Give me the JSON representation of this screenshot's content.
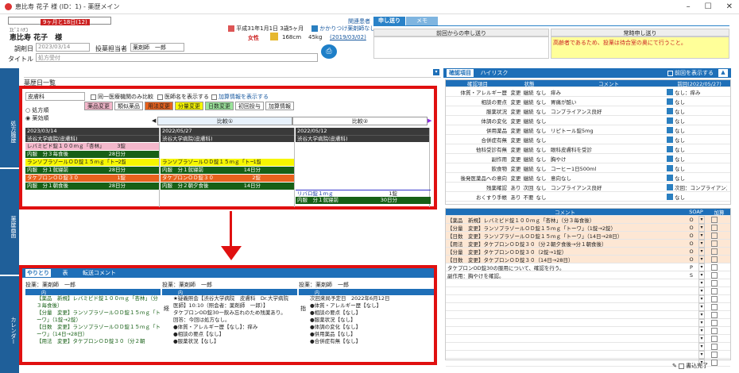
{
  "window": {
    "title": "恵比寿 花子 様 (ID：1) - 薬歴メイン"
  },
  "patient": {
    "age": "9ヶ月と18日(12)",
    "kana": "ｴﾋﾞｽ ﾊﾅｺ",
    "name": "恵比寿 花子　様",
    "birth": "平成31年1月1日 3歳5ヶ月",
    "sex": "女性",
    "height": "168cm",
    "weight": "45kg",
    "kakaritsuke": "かかりつけ薬剤師なし",
    "date_link": "(2019/03/02)",
    "related": "関連患者"
  },
  "form": {
    "date_label": "調剤日",
    "date_value": "2023/03/14",
    "pharmacist_label": "投薬担当者",
    "pharmacist_value": "薬剤師　一郎",
    "title_label": "タイトル",
    "title_value": "処方受付"
  },
  "notes": {
    "tab1": "申し送り",
    "tab2": "メモ",
    "prev_label": "前回からの申し送り",
    "always_label": "常時申し送り",
    "always_text": "高齢者であるため、投薬は待合室の奥にて行うこと。"
  },
  "history": {
    "title": "薬歴日一覧",
    "select": "皮膚科",
    "opt1": "同一医療機関のみ比較",
    "opt2": "医師名を表示する",
    "opt3": "加算情報を表示する",
    "radio1": "処方順",
    "radio2": "薬効順",
    "tags": [
      "薬品変更",
      "類似薬品",
      "用法変更",
      "分量変更",
      "日数変更",
      "初回投与",
      "加算情報"
    ],
    "compare1": "比較①",
    "compare2": "比較②",
    "columns": [
      {
        "date": "2023/03/14",
        "hosp": "渋谷大学病院(皮膚科)",
        "rows": [
          {
            "t": "レバミピド錠１００ｍｇ「杏林」",
            "n": "3錠",
            "c": "pink"
          },
          {
            "t": "内服　分３毎食後",
            "n": "28日分",
            "c": "grn"
          },
          {
            "t": "ランソプラゾールＯＤ錠１５ｍｇ「トーワ」",
            "n": "2錠",
            "c": "yel"
          },
          {
            "t": "内服　分１就寝前",
            "n": "28日分",
            "c": "grn"
          },
          {
            "t": "タケプロンＯＤ錠３０",
            "n": "1錠",
            "c": "org"
          },
          {
            "t": "内服　分１朝食後",
            "n": "28日分",
            "c": "grn"
          }
        ]
      },
      {
        "date": "2022/05/27",
        "hosp": "渋谷大学病院(皮膚科)",
        "rows": [
          {
            "t": "",
            "n": "",
            "c": ""
          },
          {
            "t": "",
            "n": "",
            "c": ""
          },
          {
            "t": "ランソプラゾールＯＤ錠１５ｍｇ「トーワ」",
            "n": "1錠",
            "c": "yel"
          },
          {
            "t": "内服　分１就寝前",
            "n": "14日分",
            "c": "grn"
          },
          {
            "t": "タケプロンＯＤ錠３０",
            "n": "2錠",
            "c": "org"
          },
          {
            "t": "内服　分２朝夕食後",
            "n": "14日分",
            "c": "grn"
          }
        ]
      },
      {
        "date": "2022/05/12",
        "hosp": "渋谷大学病院(皮膚科)",
        "rows": []
      }
    ],
    "extra": {
      "t1": "リバロ錠１ｍｇ",
      "n1": "1錠",
      "t2": "内服　分１就寝前",
      "n2": "30日分"
    }
  },
  "confirm": {
    "tab1": "確認項目",
    "tab2": "ハイリスク",
    "show_prev": "前回を表示する",
    "col_item": "確認項目",
    "col_state": "状態",
    "col_comment": "コメント",
    "col_prev": "前回(2022/05/27)",
    "rows": [
      {
        "item": "体質・アレルギー歴",
        "s1": "変更",
        "s2": "継続",
        "s3": "なし",
        "comment": "痒み",
        "prev": "なし：痒み"
      },
      {
        "item": "相談の要点",
        "s1": "変更",
        "s2": "継続",
        "s3": "なし",
        "comment": "胃痛が酷い",
        "prev": "なし"
      },
      {
        "item": "服薬状況",
        "s1": "変更",
        "s2": "継続",
        "s3": "なし",
        "comment": "コンプライアンス良好",
        "prev": "なし"
      },
      {
        "item": "体調の変化",
        "s1": "変更",
        "s2": "継続",
        "s3": "なし",
        "comment": "",
        "prev": "なし"
      },
      {
        "item": "併用薬品",
        "s1": "変更",
        "s2": "継続",
        "s3": "なし",
        "comment": "リピトール錠5mg",
        "prev": "なし"
      },
      {
        "item": "合併症有無",
        "s1": "変更",
        "s2": "継続",
        "s3": "なし",
        "comment": "",
        "prev": "なし"
      },
      {
        "item": "他科受診有無",
        "s1": "変更",
        "s2": "継続",
        "s3": "なし",
        "comment": "眼科皮膚科を受診",
        "prev": "なし"
      },
      {
        "item": "副作用",
        "s1": "変更",
        "s2": "継続",
        "s3": "なし",
        "comment": "胸やけ",
        "prev": "なし"
      },
      {
        "item": "飲食物",
        "s1": "変更",
        "s2": "継続",
        "s3": "なし",
        "comment": "コーヒー1日500ml",
        "prev": "なし"
      },
      {
        "item": "後発医薬品への意向",
        "s1": "変更",
        "s2": "継続",
        "s3": "なし",
        "comment": "意向なし",
        "prev": "なし"
      },
      {
        "item": "残薬確認",
        "s1": "あり",
        "s2": "次回",
        "s3": "なし",
        "comment": "コンプライアンス良好",
        "prev": "次回：コンプライアンス良好"
      },
      {
        "item": "おくすり手帳",
        "s1": "あり",
        "s2": "不要",
        "s3": "なし",
        "comment": "",
        "prev": "なし"
      }
    ]
  },
  "soap": {
    "col_comment": "コメント",
    "col_soap": "SOAP",
    "col_add": "加算",
    "rows": [
      {
        "t": "【薬品　新規】レバミピド錠１００ｍｇ「杏林」（分３毎食後）",
        "s": "O",
        "hl": true
      },
      {
        "t": "【分量　変更】ランソプラゾールＯＤ錠１５ｍｇ「トーワ」（1錠→2錠）",
        "s": "O",
        "hl": true
      },
      {
        "t": "【日数　変更】ランソプラゾールＯＤ錠１５ｍｇ「トーワ」（14日→28日）",
        "s": "O",
        "hl": true
      },
      {
        "t": "【用法　変更】タケプロンＯＤ錠３０（分２朝夕食後→分１朝食後）",
        "s": "O",
        "hl": true
      },
      {
        "t": "【分量　変更】タケプロンＯＤ錠３０（2錠→1錠）",
        "s": "O",
        "hl": true
      },
      {
        "t": "【日数　変更】タケプロンＯＤ錠３０（14日→28日）",
        "s": "O",
        "hl": true
      },
      {
        "t": "タケプロンOD錠30の服用について、確認を行う。",
        "s": "P",
        "hl": false
      },
      {
        "t": "副作用：胸やけを確認。",
        "s": "S",
        "hl": false
      }
    ],
    "done": "書込完了"
  },
  "bottom": {
    "tab1": "やりとり",
    "tab2": "表",
    "tab3": "転送コメント",
    "col1_title": "投薬：薬剤師　一郎",
    "col2_title": "投薬：薬剤師　一郎",
    "col3_title": "投薬：薬剤師　一郎",
    "col_head": "内",
    "col1": [
      "【薬品　新規】レバミピド錠１００ｍｇ「杏林」（分３毎食後）",
      "【分量　変更】ランソプラゾールＯＤ錠１５ｍｇ「トーワ」（1錠→2錠）",
      "【日数　変更】ランソプラゾールＯＤ錠１５ｍｇ「トーワ」（14日→28日）",
      "【用法　変更】タケプロンＯＤ錠３０（分２朝"
    ],
    "col2_mark": "経",
    "col2": [
      "★疑義照会【渋谷大学病院　皮膚科　Dr.大学病院　医師】10:10（照会者：薬剤師　一郎）】",
      "タケプロンOD錠30一飲み忘れのため残薬あり。",
      "回答：今回は処方なし。",
      "●体質・アレルギー歴【なし】：痒み",
      "●相談の要点【なし】",
      "●服薬状況【なし】"
    ],
    "col3_mark": "指",
    "col3": [
      "次回来局予定日　2022年6月12日",
      "●体質・アレルギー歴【なし】",
      "●相談の要点【なし】",
      "●服薬状況【なし】",
      "●体調の変化【なし】",
      "●併用薬品【なし】",
      "●合併症有無【なし】"
    ]
  },
  "sidebar": {
    "l1": "処方履歴",
    "l2": "薬歴画面",
    "l3": "カレンダー"
  }
}
